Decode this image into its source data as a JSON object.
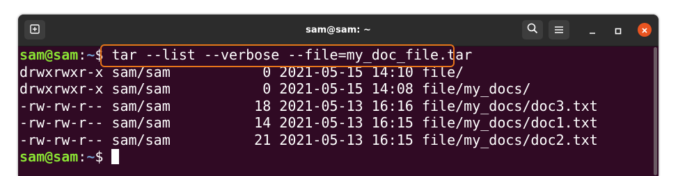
{
  "window": {
    "title": "sam@sam: ~"
  },
  "terminal": {
    "command_line": {
      "user": "sam@sam",
      "sep": ":",
      "path": "~",
      "symbol": "$",
      "command": "tar --list --verbose --file=my_doc_file.tar"
    },
    "output": [
      "drwxrwxr-x sam/sam           0 2021-05-15 14:10 file/",
      "drwxrwxr-x sam/sam           0 2021-05-15 14:08 file/my_docs/",
      "-rw-rw-r-- sam/sam          18 2021-05-13 16:16 file/my_docs/doc3.txt",
      "-rw-rw-r-- sam/sam          14 2021-05-13 16:15 file/my_docs/doc1.txt",
      "-rw-rw-r-- sam/sam          21 2021-05-13 16:15 file/my_docs/doc2.txt"
    ],
    "final_prompt": {
      "user": "sam@sam",
      "sep": ":",
      "path": "~",
      "symbol": "$ "
    }
  },
  "icons": {
    "new_tab": "new-tab-icon",
    "search": "search-icon",
    "menu": "hamburger-menu-icon",
    "minimize": "minimize-icon",
    "maximize": "maximize-icon",
    "close": "close-icon"
  },
  "colors": {
    "terminal_bg": "#300a24",
    "prompt_user": "#8ae234",
    "prompt_path": "#729fcf",
    "highlight_box": "#e8751a",
    "close_button": "#e95420"
  }
}
